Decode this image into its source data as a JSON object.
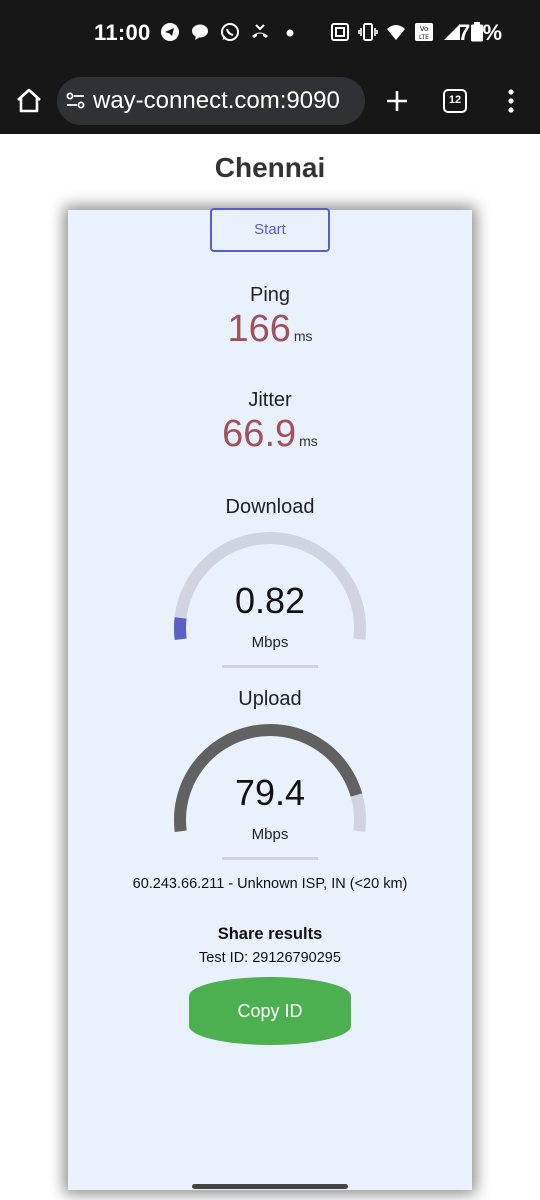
{
  "status_bar": {
    "time": "11:00",
    "battery": "76%",
    "left_icons": [
      "telegram-icon",
      "chat-bubble-icon",
      "whatsapp-icon",
      "missed-call-icon",
      "dot-icon"
    ],
    "right_icons": [
      "nfc-icon",
      "vibrate-icon",
      "wifi-icon",
      "volte-icon",
      "signal-icon",
      "battery-icon"
    ]
  },
  "browser": {
    "url": "way-connect.com:9090",
    "tab_count": "12"
  },
  "page": {
    "title": "Chennai",
    "start_label": "Start",
    "ping": {
      "label": "Ping",
      "value": "166",
      "unit": "ms"
    },
    "jitter": {
      "label": "Jitter",
      "value": "66.9",
      "unit": "ms"
    },
    "download": {
      "label": "Download",
      "value": "0.82",
      "unit": "Mbps",
      "fill_fraction": 0.07
    },
    "upload": {
      "label": "Upload",
      "value": "79.4",
      "unit": "Mbps",
      "fill_fraction": 0.88
    },
    "isp_info": "60.243.66.211 - Unknown ISP, IN (<20 km)",
    "share_title": "Share results",
    "test_id": "Test ID: 29126790295",
    "copy_label": "Copy ID"
  },
  "colors": {
    "accent": "#5a5fc7",
    "ping_value": "#a3505c",
    "gauge_track": "#cfd4df",
    "upload_fill": "#616161",
    "copy_button": "#4caf50",
    "card_bg": "#e8f1fc"
  }
}
